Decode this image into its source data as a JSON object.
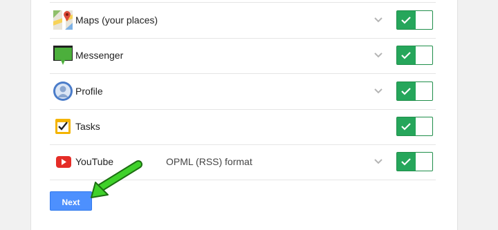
{
  "rows": [
    {
      "label": "Maps (your places)",
      "format": "",
      "icon": "maps-icon",
      "has_chevron": true,
      "enabled": true
    },
    {
      "label": "Messenger",
      "format": "",
      "icon": "messenger-icon",
      "has_chevron": true,
      "enabled": true
    },
    {
      "label": "Profile",
      "format": "",
      "icon": "profile-icon",
      "has_chevron": true,
      "enabled": true
    },
    {
      "label": "Tasks",
      "format": "",
      "icon": "tasks-icon",
      "has_chevron": false,
      "enabled": true
    },
    {
      "label": "YouTube",
      "format": "OPML (RSS) format",
      "icon": "youtube-icon",
      "has_chevron": true,
      "enabled": true
    }
  ],
  "next_label": "Next",
  "colors": {
    "toggle_on": "#26a65b",
    "button": "#4d90fe",
    "annotation_arrow": "#3fd12a"
  }
}
